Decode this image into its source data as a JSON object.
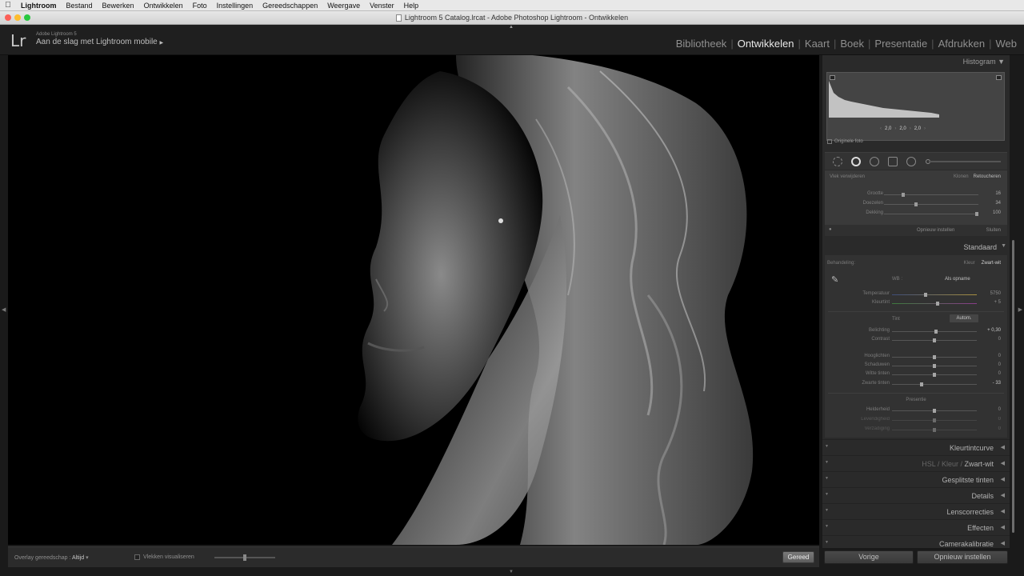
{
  "menubar": {
    "items": [
      "Lightroom",
      "Bestand",
      "Bewerken",
      "Ontwikkelen",
      "Foto",
      "Instellingen",
      "Gereedschappen",
      "Weergave",
      "Venster",
      "Help"
    ]
  },
  "window": {
    "title": "Lightroom 5 Catalog.lrcat - Adobe Photoshop Lightroom - Ontwikkelen"
  },
  "identity": {
    "product": "Adobe Lightroom 5",
    "tagline": "Aan de slag met Lightroom mobile",
    "logo": "Lr"
  },
  "modules": {
    "items": [
      "Bibliotheek",
      "Ontwikkelen",
      "Kaart",
      "Boek",
      "Presentatie",
      "Afdrukken",
      "Web"
    ],
    "active": "Ontwikkelen"
  },
  "histogram": {
    "title": "Histogram",
    "values": [
      "2,0",
      "2,0",
      "2,0"
    ],
    "original_photo_label": "Originele foto"
  },
  "spot_removal": {
    "header": "Vlek verwijderen",
    "mode_klonen": "Klonen",
    "mode_retoucheren": "Retoucheren",
    "sliders": [
      {
        "label": "Grootte",
        "value": "16",
        "pos": 0.2
      },
      {
        "label": "Doezelen",
        "value": "34",
        "pos": 0.34
      },
      {
        "label": "Dekking",
        "value": "100",
        "pos": 0.98
      }
    ],
    "reset_label": "Opnieuw instellen",
    "close_label": "Sluiten"
  },
  "basic": {
    "preset": "Standaard",
    "treatment_label": "Behandeling:",
    "treatment_color": "Kleur",
    "treatment_bw": "Zwart-wit",
    "wb_label": "WB :",
    "wb_value": "Als opname",
    "temp_label": "Temperatuur",
    "temp_value": "5750",
    "tint_label": "Kleurtint",
    "tint_value": "+ 5",
    "tone_label": "Tint",
    "auto_label": "Autom.",
    "tone_sliders": [
      {
        "label": "Belichting",
        "value": "+ 0,30",
        "pos": 0.52
      },
      {
        "label": "Contrast",
        "value": "0",
        "pos": 0.5
      }
    ],
    "detail_sliders": [
      {
        "label": "Hooglichten",
        "value": "0",
        "pos": 0.5
      },
      {
        "label": "Schaduwen",
        "value": "0",
        "pos": 0.5
      },
      {
        "label": "Witte tinten",
        "value": "0",
        "pos": 0.5
      },
      {
        "label": "Zwarte tinten",
        "value": "- 33",
        "pos": 0.35
      }
    ],
    "presence_label": "Presentie",
    "presence_sliders": [
      {
        "label": "Helderheid",
        "value": "0",
        "pos": 0.5
      },
      {
        "label": "Levendigheid",
        "value": "0",
        "pos": 0.5
      },
      {
        "label": "Verzadiging",
        "value": "0",
        "pos": 0.5
      }
    ]
  },
  "panels": {
    "tone_curve": "Kleurtintcurve",
    "hsl_hsl": "HSL",
    "hsl_color": "Kleur",
    "hsl_bw": "Zwart-wit",
    "split_toning": "Gesplitste tinten",
    "details": "Details",
    "lens": "Lenscorrecties",
    "effects": "Effecten",
    "camera": "Camerakalibratie"
  },
  "bottom_buttons": {
    "previous": "Vorige",
    "reset": "Opnieuw instellen"
  },
  "toolbar": {
    "overlay_label": "Overlay gereedschap :",
    "overlay_value": "Altijd",
    "visualize_label": "Vlekken visualiseren",
    "done_label": "Gereed"
  }
}
